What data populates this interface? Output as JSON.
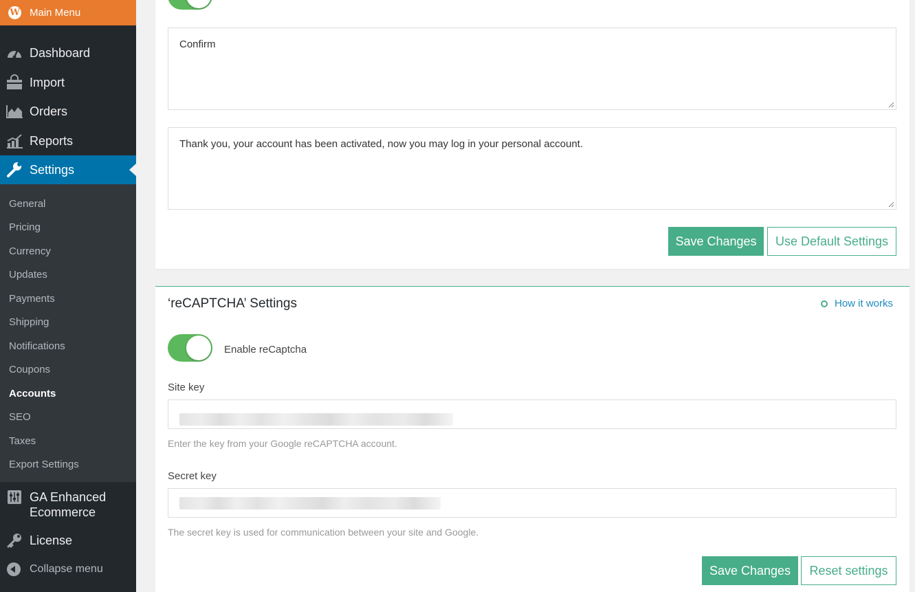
{
  "sidebar": {
    "main_menu": "Main Menu",
    "items": [
      {
        "label": "Dashboard",
        "icon": "dashboard-icon"
      },
      {
        "label": "Import",
        "icon": "shopping-bag-icon"
      },
      {
        "label": "Orders",
        "icon": "area-chart-icon"
      },
      {
        "label": "Reports",
        "icon": "chart-icon"
      },
      {
        "label": "Settings",
        "icon": "wrench-icon"
      }
    ],
    "submenu": [
      "General",
      "Pricing",
      "Currency",
      "Updates",
      "Payments",
      "Shipping",
      "Notifications",
      "Coupons",
      "Accounts",
      "SEO",
      "Taxes",
      "Export Settings"
    ],
    "current_submenu": "Accounts",
    "ga_label": "GA Enhanced Ecommerce",
    "license_label": "License",
    "collapse_label": "Collapse menu"
  },
  "accounts_card": {
    "textarea_confirm": "Confirm",
    "textarea_message": "Thank you, your account has been activated, now you may log in your personal account.",
    "save_label": "Save Changes",
    "default_label": "Use Default Settings",
    "toggle_on": true
  },
  "recaptcha": {
    "title": "‘reCAPTCHA’ Settings",
    "how_it_works": "How it works",
    "enable_label": "Enable reCaptcha",
    "enabled": true,
    "site_key_label": "Site key",
    "site_key_hint": "Enter the key from your Google reCAPTCHA account.",
    "secret_key_label": "Secret key",
    "secret_key_hint": "The secret key is used for communication between your site and Google.",
    "save_label": "Save Changes",
    "reset_label": "Reset settings"
  },
  "colors": {
    "accent": "#48ad89",
    "sidebar_bg": "#23282d",
    "active": "#0073aa",
    "main_menu_bg": "#e87b2e",
    "toggle_on": "#5cb85c"
  }
}
